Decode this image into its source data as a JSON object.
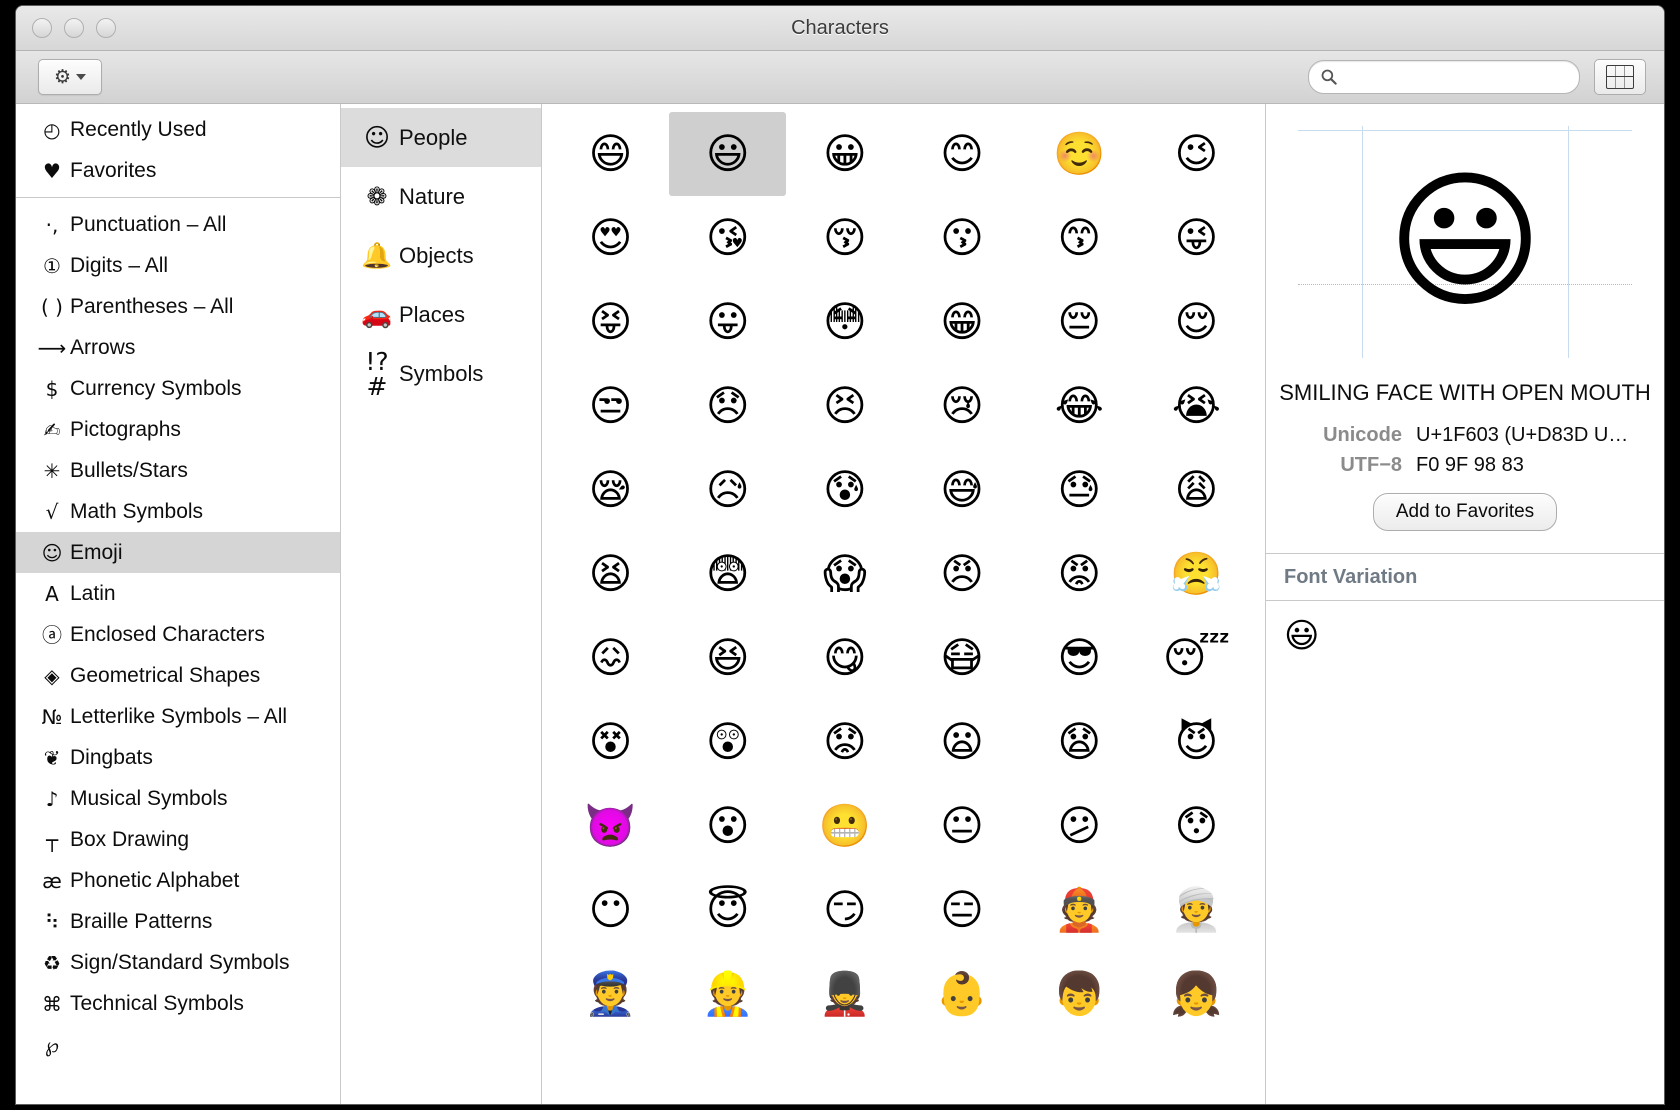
{
  "window": {
    "title": "Characters",
    "traffic_lights": [
      "close",
      "minimize",
      "zoom"
    ]
  },
  "toolbar": {
    "gear_glyph": "⚙",
    "gear_label": "action-menu",
    "search_placeholder": "",
    "search_value": "",
    "search_icon": "search-icon",
    "character_picker_icon": "character-palette-icon"
  },
  "sidebar": {
    "top_items": [
      {
        "icon": "🕓",
        "glyph": "◴",
        "label": "Recently Used",
        "selected": false
      },
      {
        "icon": "heart",
        "glyph": "♥",
        "label": "Favorites",
        "selected": false
      }
    ],
    "items": [
      {
        "glyph": "·,",
        "label": "Punctuation – All",
        "selected": false
      },
      {
        "glyph": "①",
        "label": "Digits – All",
        "selected": false
      },
      {
        "glyph": "( )",
        "label": "Parentheses – All",
        "selected": false
      },
      {
        "glyph": "⟶",
        "label": "Arrows",
        "selected": false
      },
      {
        "glyph": "$",
        "label": "Currency Symbols",
        "selected": false
      },
      {
        "glyph": "✍",
        "label": "Pictographs",
        "selected": false
      },
      {
        "glyph": "✳",
        "label": "Bullets/Stars",
        "selected": false
      },
      {
        "glyph": "√",
        "label": "Math Symbols",
        "selected": false
      },
      {
        "glyph": "☺",
        "label": "Emoji",
        "selected": true
      },
      {
        "glyph": "A",
        "label": "Latin",
        "selected": false
      },
      {
        "glyph": "ⓐ",
        "label": "Enclosed Characters",
        "selected": false
      },
      {
        "glyph": "◈",
        "label": "Geometrical Shapes",
        "selected": false
      },
      {
        "glyph": "№",
        "label": "Letterlike Symbols – All",
        "selected": false
      },
      {
        "glyph": "❦",
        "label": "Dingbats",
        "selected": false
      },
      {
        "glyph": "♪",
        "label": "Musical Symbols",
        "selected": false
      },
      {
        "glyph": "┬",
        "label": "Box Drawing",
        "selected": false
      },
      {
        "glyph": "æ",
        "label": "Phonetic Alphabet",
        "selected": false
      },
      {
        "glyph": "⠳",
        "label": "Braille Patterns",
        "selected": false
      },
      {
        "glyph": "♻",
        "label": "Sign/Standard Symbols",
        "selected": false
      },
      {
        "glyph": "⌘",
        "label": "Technical Symbols",
        "selected": false
      },
      {
        "glyph": "℘",
        "label": "",
        "selected": false
      }
    ]
  },
  "categories": [
    {
      "glyph": "☺",
      "label": "People",
      "selected": true
    },
    {
      "glyph": "❁",
      "label": "Nature",
      "selected": false
    },
    {
      "glyph": "🔔",
      "label": "Objects",
      "selected": false
    },
    {
      "glyph": "🚗",
      "label": "Places",
      "selected": false
    },
    {
      "glyph": "!?#",
      "label": "Symbols",
      "selected": false
    }
  ],
  "grid": {
    "selected_index": 1,
    "emoji": [
      "😄",
      "😃",
      "😀",
      "😊",
      "☺️",
      "😉",
      "😍",
      "😘",
      "😚",
      "😗",
      "😙",
      "😜",
      "😝",
      "😛",
      "😳",
      "😁",
      "😔",
      "😌",
      "😒",
      "😞",
      "😣",
      "😢",
      "😂",
      "😭",
      "😪",
      "😥",
      "😰",
      "😅",
      "😓",
      "😩",
      "😫",
      "😨",
      "😱",
      "😠",
      "😡",
      "😤",
      "😖",
      "😆",
      "😋",
      "😷",
      "😎",
      "😴",
      "😵",
      "😲",
      "😟",
      "😦",
      "😧",
      "😈",
      "👿",
      "😮",
      "😬",
      "😐",
      "😕",
      "😯",
      "😶",
      "😇",
      "😏",
      "😑",
      "👲",
      "👳",
      "👮",
      "👷",
      "💂",
      "👶",
      "👦",
      "👧"
    ]
  },
  "detail": {
    "character": "😃",
    "name": "SMILING FACE WITH OPEN MOUTH",
    "meta": [
      {
        "key": "Unicode",
        "value": "U+1F603 (U+D83D U…"
      },
      {
        "key": "UTF−8",
        "value": "F0 9F 98 83"
      }
    ],
    "add_to_favorites_label": "Add to Favorites",
    "font_variation_title": "Font Variation",
    "font_variations": [
      "😃"
    ]
  },
  "colors": {
    "selection_gray": "#d5d5d5",
    "category_selection_gray": "#dcdcdc",
    "cell_selection_gray": "#cfcfcf",
    "meta_key_gray": "#8b8b8b",
    "font_variation_blue_gray": "#6f7a85",
    "guide_blue": "#c8dced"
  }
}
